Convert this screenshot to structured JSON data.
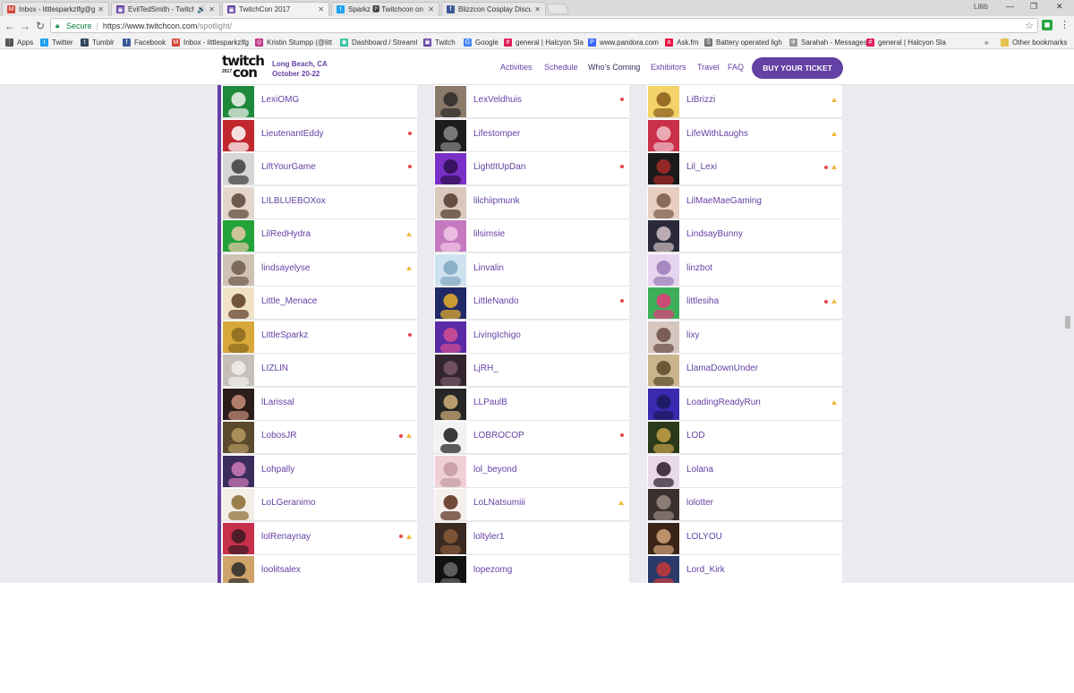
{
  "browser": {
    "tabs": [
      {
        "title": "Inbox - littlesparkzlfg@g",
        "icon": "gmail-icon",
        "color": "#d44638",
        "glyph": "M"
      },
      {
        "title": "EvilTedSmith - Twitch",
        "icon": "twitch-icon",
        "color": "#6441a4",
        "glyph": "▣",
        "audio": "🔊"
      },
      {
        "title": "TwitchCon 2017",
        "icon": "twitch-icon",
        "color": "#6441a4",
        "glyph": "▣",
        "active": true
      },
      {
        "title": "Sparkz 🅿 Twitchcon on",
        "icon": "twitter-icon",
        "color": "#1da1f2",
        "glyph": "t"
      },
      {
        "title": "Blizzcon Cosplay Discus",
        "icon": "facebook-icon",
        "color": "#3b5998",
        "glyph": "f"
      }
    ],
    "close_glyph": "✕",
    "user": "Lillib",
    "url": {
      "secure_label": "Secure",
      "separator": "|",
      "host": "https://www.twitchcon.com",
      "path": "/spotlight/"
    },
    "bookmarks": [
      {
        "label": "Apps",
        "icon": "apps-icon",
        "color": "#555",
        "glyph": "⋮"
      },
      {
        "label": "Twitter",
        "icon": "twitter-icon",
        "color": "#1da1f2",
        "glyph": "t"
      },
      {
        "label": "Tumblr",
        "icon": "tumblr-icon",
        "color": "#35465c",
        "glyph": "t"
      },
      {
        "label": "Facebook",
        "icon": "facebook-icon",
        "color": "#3b5998",
        "glyph": "f"
      },
      {
        "label": "Inbox - littlesparkzlfg",
        "icon": "gmail-icon",
        "color": "#d44638",
        "glyph": "M"
      },
      {
        "label": "Kristin Stumpp (@litt",
        "icon": "instagram-icon",
        "color": "#c13584",
        "glyph": "◎"
      },
      {
        "label": "Dashboard / Streaml",
        "icon": "streamlabs-icon",
        "color": "#31c3a2",
        "glyph": "◉"
      },
      {
        "label": "Twitch",
        "icon": "twitch-icon",
        "color": "#6441a4",
        "glyph": "▣"
      },
      {
        "label": "Google",
        "icon": "google-icon",
        "color": "#4285f4",
        "glyph": "G"
      },
      {
        "label": "general | Halcyon Sla",
        "icon": "slack-icon",
        "color": "#e01e5a",
        "glyph": "#"
      },
      {
        "label": "www.pandora.com",
        "icon": "pandora-icon",
        "color": "#3668ff",
        "glyph": "P"
      },
      {
        "label": "Ask.fm",
        "icon": "askfm-icon",
        "color": "#ee1144",
        "glyph": "a"
      },
      {
        "label": "Battery operated ligh",
        "icon": "page-icon",
        "color": "#777",
        "glyph": "S"
      },
      {
        "label": "Sarahah - Messages",
        "icon": "sarahah-icon",
        "color": "#999",
        "glyph": "✈"
      },
      {
        "label": "general | Halcyon Sla",
        "icon": "slack-icon",
        "color": "#e01e5a",
        "glyph": "#"
      }
    ],
    "bookmarks_overflow": "»",
    "other_bookmarks": "Other bookmarks"
  },
  "header": {
    "logo": {
      "line1": "twitch",
      "line2": "con",
      "year": "2017"
    },
    "location": "Long Beach, CA",
    "dates": "October 20-22",
    "nav": [
      "Activities",
      "Schedule",
      "Who's Coming",
      "Exhibitors",
      "Travel",
      "FAQ"
    ],
    "current_nav": "Who's Coming",
    "cta": "BUY YOUR TICKET"
  },
  "colors": {
    "accent": "#6441a4",
    "live_dot": "#e24a4a",
    "partner_badge": "#f2b63a"
  },
  "columns": [
    [
      {
        "name": "LexiOMG",
        "badges": [],
        "c1": "#1f8a3a",
        "c2": "#f4f4f4"
      },
      {
        "name": "LieutenantEddy",
        "badges": [
          "dot"
        ],
        "c1": "#c0282d",
        "c2": "#ffffff"
      },
      {
        "name": "LiftYourGame",
        "badges": [
          "dot"
        ],
        "c1": "#d6d6d6",
        "c2": "#3b3b3b"
      },
      {
        "name": "LILBLUEBOXox",
        "badges": [],
        "c1": "#e4d6cc",
        "c2": "#5b4436"
      },
      {
        "name": "LilRedHydra",
        "badges": [
          "tri"
        ],
        "c1": "#23a23a",
        "c2": "#e9c9a8"
      },
      {
        "name": "lindsayelyse",
        "badges": [
          "tri"
        ],
        "c1": "#cfc2b4",
        "c2": "#6f5a4b"
      },
      {
        "name": "Little_Menace",
        "badges": [],
        "c1": "#f0e2c5",
        "c2": "#5a3c22"
      },
      {
        "name": "LittleSparkz",
        "badges": [
          "dot"
        ],
        "c1": "#d8a83a",
        "c2": "#8a6a1e"
      },
      {
        "name": "LIZLIN",
        "badges": [],
        "c1": "#c7c0ba",
        "c2": "#f1efef"
      },
      {
        "name": "lLarissal",
        "badges": [],
        "c1": "#2b1d1a",
        "c2": "#c98f7a"
      },
      {
        "name": "LobosJR",
        "badges": [
          "dot",
          "tri"
        ],
        "c1": "#5b4a2c",
        "c2": "#b89a63"
      },
      {
        "name": "Lohpally",
        "badges": [],
        "c1": "#3b2d5e",
        "c2": "#d07bb8"
      },
      {
        "name": "LoLGeranimo",
        "badges": [],
        "c1": "#f3efe6",
        "c2": "#8a6a2f"
      },
      {
        "name": "lolRenaynay",
        "badges": [
          "dot",
          "tri"
        ],
        "c1": "#c7304a",
        "c2": "#3a1a22"
      },
      {
        "name": "loolitsalex",
        "badges": [],
        "c1": "#cfa36a",
        "c2": "#2a2a2a"
      }
    ],
    [
      {
        "name": "LexVeldhuis",
        "badges": [
          "dot"
        ],
        "c1": "#8b7a6a",
        "c2": "#2a2a2a"
      },
      {
        "name": "Lifestomper",
        "badges": [],
        "c1": "#1d1d1d",
        "c2": "#8a8a8a"
      },
      {
        "name": "LightItUpDan",
        "badges": [
          "dot"
        ],
        "c1": "#7a2fc7",
        "c2": "#2e0e4d"
      },
      {
        "name": "lilchiipmunk",
        "badges": [],
        "c1": "#d9c8bd",
        "c2": "#51392b"
      },
      {
        "name": "lilsimsie",
        "badges": [],
        "c1": "#c57ac0",
        "c2": "#f2c7e7"
      },
      {
        "name": "Linvalin",
        "badges": [],
        "c1": "#cfe2ef",
        "c2": "#7fa7c2"
      },
      {
        "name": "LittleNando",
        "badges": [
          "dot"
        ],
        "c1": "#1f2a66",
        "c2": "#e9b02b"
      },
      {
        "name": "LivingIchigo",
        "badges": [],
        "c1": "#5b2aa6",
        "c2": "#d44f92"
      },
      {
        "name": "LjRH_",
        "badges": [],
        "c1": "#332530",
        "c2": "#7a5a6a"
      },
      {
        "name": "LLPaulB",
        "badges": [],
        "c1": "#262626",
        "c2": "#d5b07a"
      },
      {
        "name": "LOBROCOP",
        "badges": [
          "dot"
        ],
        "c1": "#f2f2f2",
        "c2": "#1a1a1a"
      },
      {
        "name": "lol_beyond",
        "badges": [],
        "c1": "#f0d0d6",
        "c2": "#c49aa3"
      },
      {
        "name": "LoLNatsumiii",
        "badges": [
          "tri"
        ],
        "c1": "#f6f0ec",
        "c2": "#5a2a1a"
      },
      {
        "name": "loltyler1",
        "badges": [],
        "c1": "#3a2a22",
        "c2": "#8a5a3a"
      },
      {
        "name": "lopezomg",
        "badges": [],
        "c1": "#111111",
        "c2": "#6a6a6a"
      }
    ],
    [
      {
        "name": "LiBrizzi",
        "badges": [
          "tri"
        ],
        "c1": "#f3d36a",
        "c2": "#8a5a1a"
      },
      {
        "name": "LifeWithLaughs",
        "badges": [
          "tri"
        ],
        "c1": "#c9304a",
        "c2": "#f0c0c8"
      },
      {
        "name": "Lil_Lexi",
        "badges": [
          "dot",
          "tri"
        ],
        "c1": "#1a1a1a",
        "c2": "#a82a2a"
      },
      {
        "name": "LilMaeMaeGaming",
        "badges": [],
        "c1": "#e8cfc2",
        "c2": "#7a5a4a"
      },
      {
        "name": "LindsayBunny",
        "badges": [],
        "c1": "#2a2a3a",
        "c2": "#d6c2c8"
      },
      {
        "name": "linzbot",
        "badges": [],
        "c1": "#e7d5ef",
        "c2": "#9b7ab8"
      },
      {
        "name": "littlesiha",
        "badges": [
          "dot",
          "tri"
        ],
        "c1": "#3fae5a",
        "c2": "#e5397a"
      },
      {
        "name": "lixy",
        "badges": [],
        "c1": "#d6c6c0",
        "c2": "#6a4a40"
      },
      {
        "name": "LlamaDownUnder",
        "badges": [],
        "c1": "#cab48c",
        "c2": "#5a4a2a"
      },
      {
        "name": "LoadingReadyRun",
        "badges": [
          "tri"
        ],
        "c1": "#3a2ab0",
        "c2": "#1a1a5a"
      },
      {
        "name": "LOD",
        "badges": [],
        "c1": "#2a3a1a",
        "c2": "#c6a24a"
      },
      {
        "name": "Lolana",
        "badges": [],
        "c1": "#e8d8e8",
        "c2": "#2a1a2a"
      },
      {
        "name": "lolotter",
        "badges": [],
        "c1": "#3a3030",
        "c2": "#9a8a80"
      },
      {
        "name": "LOLYOU",
        "badges": [],
        "c1": "#3a2418",
        "c2": "#d4a478"
      },
      {
        "name": "Lord_Kirk",
        "badges": [],
        "c1": "#2a3a6a",
        "c2": "#c63a3a"
      }
    ]
  ]
}
